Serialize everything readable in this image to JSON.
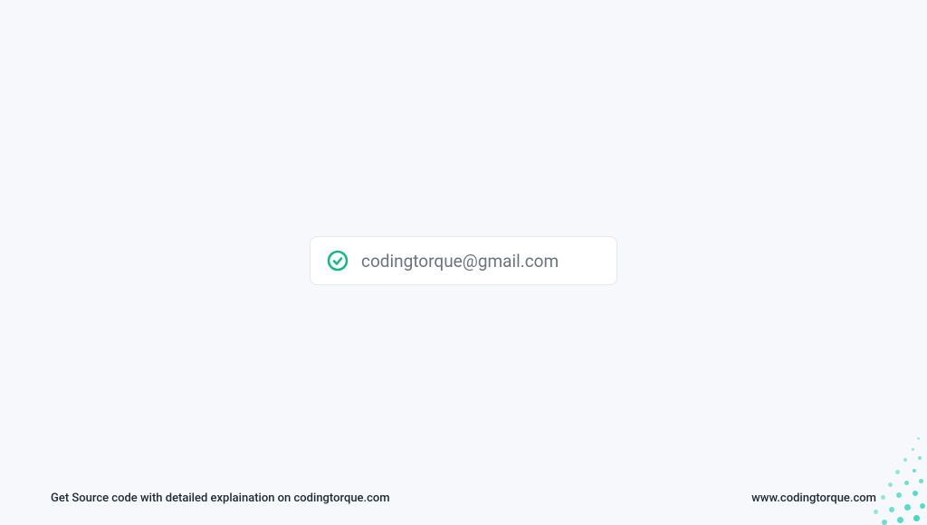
{
  "email_field": {
    "value": "codingtorque@gmail.com",
    "validation_state": "valid"
  },
  "footer": {
    "tagline": "Get Source code with detailed explaination on codingtorque.com",
    "website": "www.codingtorque.com"
  },
  "colors": {
    "success": "#10b981",
    "background": "#f7f8fb",
    "text_muted": "#6b7280",
    "decoration": "#2dd4bf"
  }
}
